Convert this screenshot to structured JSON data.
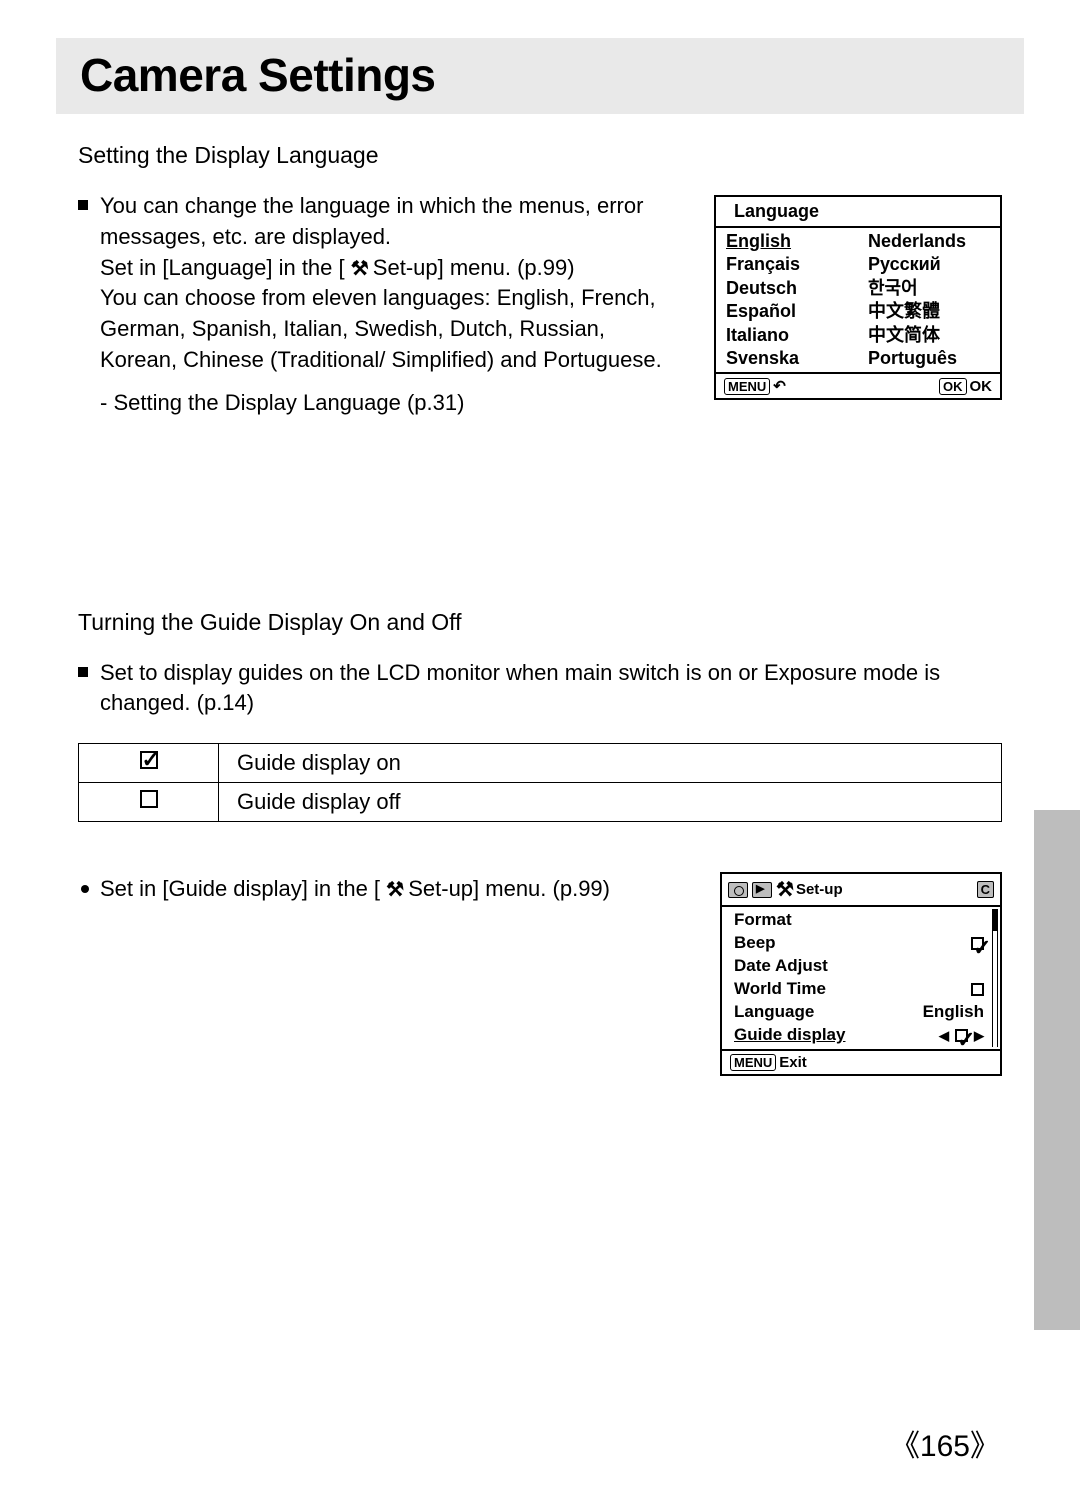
{
  "title": "Camera Settings",
  "section1": {
    "heading": "Setting the Display Language",
    "para1": "You can change the language in which the menus, error messages, etc. are displayed.",
    "para2a": "Set in [Language] in the [ ",
    "para2b": " Set-up] menu. (p.99)",
    "para3": "You can choose from eleven languages: English, French, German, Spanish, Italian, Swedish, Dutch, Russian, Korean, Chinese (Traditional/ Simplified) and Portuguese.",
    "sub": "- Setting the Display Language (p.31)"
  },
  "langMenu": {
    "title": "Language",
    "col1": [
      "English",
      "Français",
      "Deutsch",
      "Español",
      "Italiano",
      "Svenska"
    ],
    "col2": [
      "Nederlands",
      "Русский",
      "한국어",
      "中文繁體",
      "中文简体",
      "Português"
    ],
    "selectedIndex": 0,
    "menuLabel": "MENU",
    "okLabel": "OK",
    "okText": "OK"
  },
  "section2": {
    "heading": "Turning the Guide Display On and Off",
    "para1": "Set to display guides on the LCD monitor when main switch is on or Exposure mode is changed. (p.14)",
    "tableRow1": "Guide display on",
    "tableRow2": "Guide display off",
    "para2a": "Set in [Guide display] in the [ ",
    "para2b": " Set-up] menu. (p.99)"
  },
  "setupMenu": {
    "title": "Set-up",
    "rows": [
      {
        "label": "Format",
        "value": ""
      },
      {
        "label": "Beep",
        "value": "check"
      },
      {
        "label": "Date Adjust",
        "value": ""
      },
      {
        "label": "World Time",
        "value": "box"
      },
      {
        "label": "Language",
        "value": "English"
      },
      {
        "label": "Guide display",
        "value": "selector",
        "selected": true
      }
    ],
    "cBadge": "C",
    "footerMenu": "MENU",
    "footerExit": "Exit"
  },
  "pageNumber": "《165》",
  "toolGlyph": "⚒"
}
